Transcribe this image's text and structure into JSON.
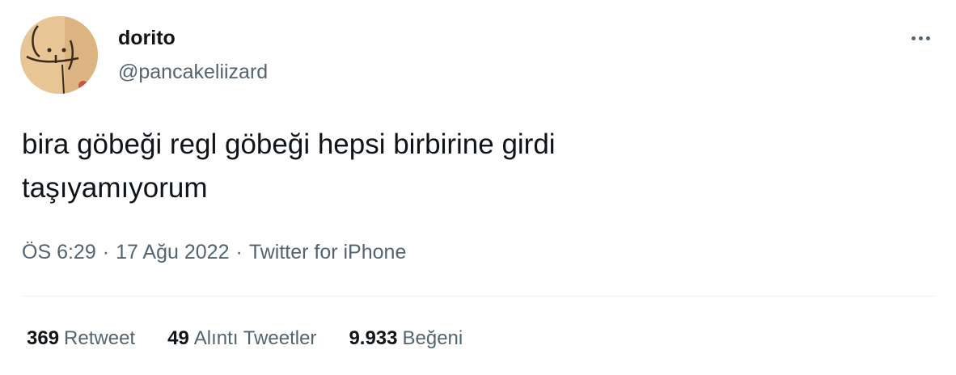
{
  "author": {
    "display_name": "dorito",
    "handle": "@pancakeliizard",
    "avatar_icon": "doodle-face-avatar"
  },
  "more_icon": "more-horizontal-icon",
  "tweet": {
    "text_lines": [
      "bira göbeği regl göbeği hepsi birbirine girdi",
      "taşıyamıyorum"
    ]
  },
  "meta": {
    "time": "ÖS 6:29",
    "separator": "·",
    "date": "17 Ağu 2022",
    "source": "Twitter for iPhone"
  },
  "stats": [
    {
      "count": "369",
      "label": "Retweet"
    },
    {
      "count": "49",
      "label": "Alıntı Tweetler"
    },
    {
      "count": "9.933",
      "label": "Beğeni"
    }
  ],
  "colors": {
    "primary_text": "#0f1419",
    "secondary_text": "#536471",
    "divider": "#eff3f4"
  }
}
